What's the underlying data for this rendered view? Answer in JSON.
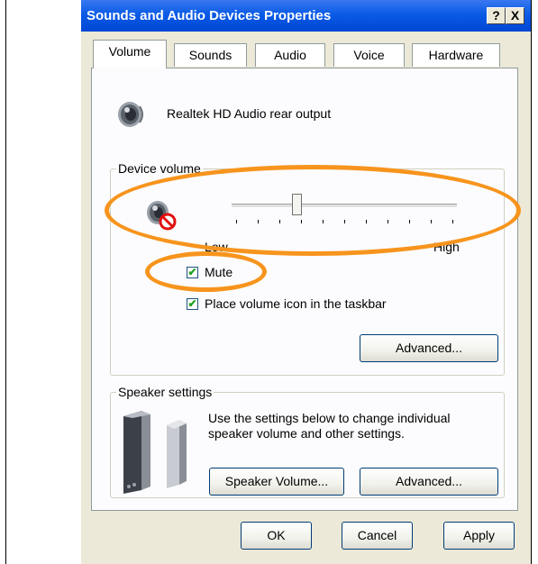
{
  "window": {
    "title": "Sounds and Audio Devices Properties",
    "help_label": "?",
    "close_label": "X"
  },
  "tabs": [
    {
      "label": "Volume",
      "active": true
    },
    {
      "label": "Sounds"
    },
    {
      "label": "Audio"
    },
    {
      "label": "Voice"
    },
    {
      "label": "Hardware"
    }
  ],
  "device": {
    "name": "Realtek HD Audio rear output",
    "icon": "speaker-icon"
  },
  "device_volume": {
    "group_label": "Device volume",
    "icon": "muted-speaker-icon",
    "slider_level": 0.28,
    "low_label": "Low",
    "high_label": "High",
    "mute_label": "Mute",
    "mute_checked": true,
    "taskbar_label": "Place volume icon in the taskbar",
    "taskbar_checked": true,
    "advanced_label": "Advanced..."
  },
  "speaker_settings": {
    "group_label": "Speaker settings",
    "description": "Use the settings below to change individual speaker volume and other settings.",
    "icon": "speakers-icon",
    "volume_button": "Speaker Volume...",
    "advanced_label": "Advanced..."
  },
  "buttons": {
    "ok": "OK",
    "cancel": "Cancel",
    "apply": "Apply"
  },
  "check_glyph": "✔",
  "highlight_color": "#F7941D"
}
